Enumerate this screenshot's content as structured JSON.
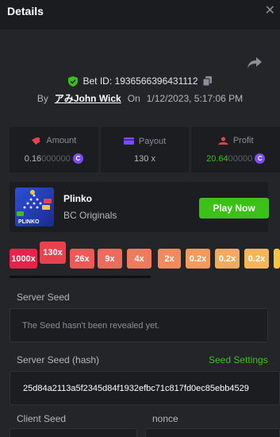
{
  "header": {
    "title": "Details",
    "close_glyph": "✕"
  },
  "bet": {
    "bet_label": "Bet ID:",
    "bet_id": "1936566396431112",
    "by_label": "By",
    "user": "アみJohn Wick",
    "on_label": "On",
    "datetime": "1/12/2023, 5:17:06 PM"
  },
  "stats": {
    "amount": {
      "label": "Amount",
      "value_main": "0.16",
      "value_dim": "000000"
    },
    "payout": {
      "label": "Payout",
      "value": "130 x"
    },
    "profit": {
      "label": "Profit",
      "value_main": "20.64",
      "value_dim": "00000"
    },
    "coin_glyph": "C"
  },
  "game": {
    "name": "Plinko",
    "provider": "BC Originals",
    "play_label": "Play Now",
    "thumb_text": "PLINKO"
  },
  "multipliers": [
    {
      "label": "1000x",
      "color": "#e6234a"
    },
    {
      "label": "130x",
      "color": "#e8424f"
    },
    {
      "label": "26x",
      "color": "#ec5a57"
    },
    {
      "label": "9x",
      "color": "#ee6a5c"
    },
    {
      "label": "4x",
      "color": "#f07a5d"
    },
    {
      "label": "2x",
      "color": "#f28a5f"
    },
    {
      "label": "0.2x",
      "color": "#f39a5f"
    },
    {
      "label": "0.2x",
      "color": "#f4aa5d"
    },
    {
      "label": "0.2x",
      "color": "#f5b55a"
    }
  ],
  "seeds": {
    "server_seed_label": "Server Seed",
    "server_seed_value": "The Seed hasn't been revealed yet.",
    "server_hash_label": "Server Seed (hash)",
    "seed_settings_label": "Seed Settings",
    "server_hash_value": "25d84a2113a5f2345d84f1932efbc71c817fd0ec85ebb4529",
    "client_seed_label": "Client Seed",
    "nonce_label": "nonce"
  },
  "colors": {
    "accent_green": "#3bc117",
    "coin_purple": "#7b4cf6",
    "shield_green": "#3bc117"
  },
  "icons": {
    "close": "close-icon",
    "share": "share-icon",
    "shield": "shield-check-icon",
    "copy": "copy-icon",
    "amount": "coins-icon",
    "payout": "wallet-icon",
    "profit": "profit-icon",
    "coin": "coin-icon"
  }
}
